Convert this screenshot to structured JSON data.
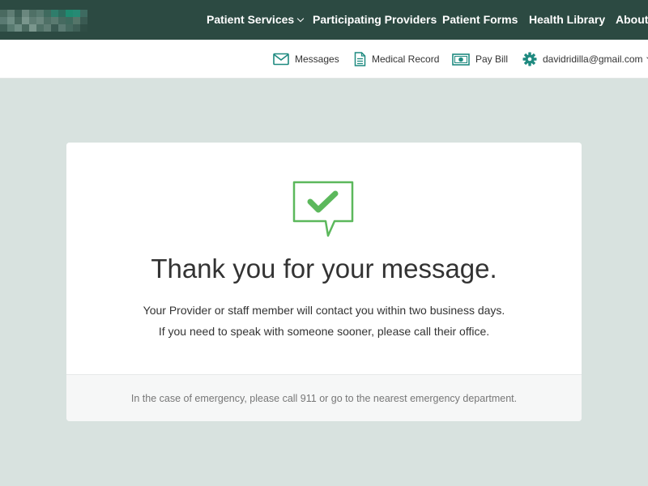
{
  "nav": {
    "items": [
      {
        "label": "Patient Services",
        "has_dropdown": true
      },
      {
        "label": "Participating Providers"
      },
      {
        "label": "Patient Forms"
      },
      {
        "label": "Health Library"
      },
      {
        "label": "About"
      }
    ]
  },
  "utility": {
    "messages": "Messages",
    "medical_record": "Medical Record",
    "pay_bill": "Pay Bill",
    "account_email": "davidridilla@gmail.com"
  },
  "confirmation": {
    "title": "Thank you for your message.",
    "line1": "Your Provider or staff member will contact you within two business days.",
    "line2": "If you need to speak with someone sooner, please call their office.",
    "footer": "In the case of emergency, please call 911 or go to the nearest emergency department."
  },
  "colors": {
    "nav_bg": "#2c4a42",
    "accent_teal": "#1f8a80",
    "success_green": "#5cb85c",
    "page_bg": "#d8e2df"
  }
}
